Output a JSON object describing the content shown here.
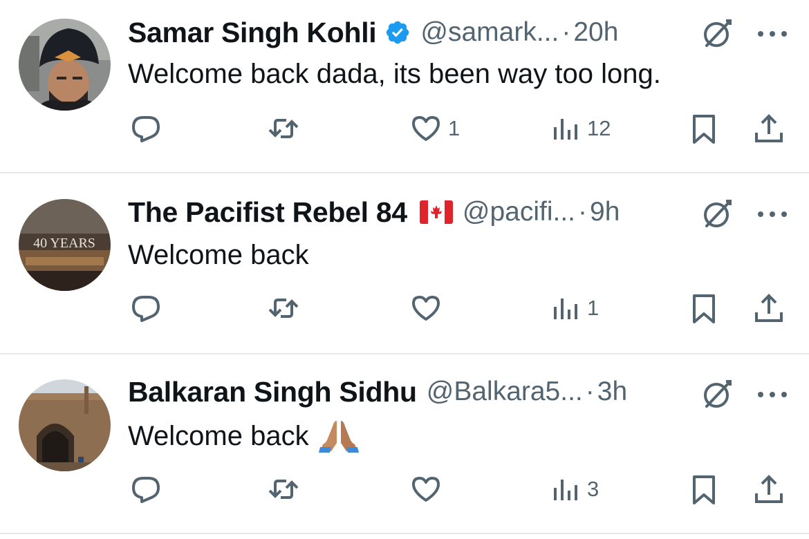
{
  "replies": [
    {
      "name": "Samar Singh Kohli",
      "verified": true,
      "flag": false,
      "handle": "@samark...",
      "dot": "·",
      "time": "20h",
      "text": "Welcome back dada, its been way too long.",
      "emoji": false,
      "likes": "1",
      "views": "12",
      "avatar": "man-in-black-turban"
    },
    {
      "name": "The Pacifist Rebel 84",
      "verified": false,
      "flag": true,
      "handle": "@pacifi...",
      "dot": "·",
      "time": "9h",
      "text": "Welcome back",
      "emoji": false,
      "likes": "",
      "views": "1",
      "avatar": "40 YEARS",
      "avatar_text": "40 YEARS"
    },
    {
      "name": "Balkaran Singh Sidhu",
      "verified": false,
      "flag": false,
      "handle": "@Balkara5...",
      "dot": "·",
      "time": "3h",
      "text": "Welcome back",
      "emoji": true,
      "emoji_name": "folded-hands-emoji",
      "likes": "",
      "views": "3",
      "avatar": "historic-arch-building"
    }
  ],
  "icons": {
    "reply": "reply-icon",
    "repost": "repost-icon",
    "like": "heart-icon",
    "views": "views-icon",
    "bookmark": "bookmark-icon",
    "share": "share-icon",
    "grok": "grok-icon",
    "more": "more-icon",
    "verified": "verified-badge-icon"
  },
  "colors": {
    "text": "#0f1419",
    "secondary": "#536471",
    "verified": "#1d9bf0",
    "separator": "#e6e9ec"
  }
}
